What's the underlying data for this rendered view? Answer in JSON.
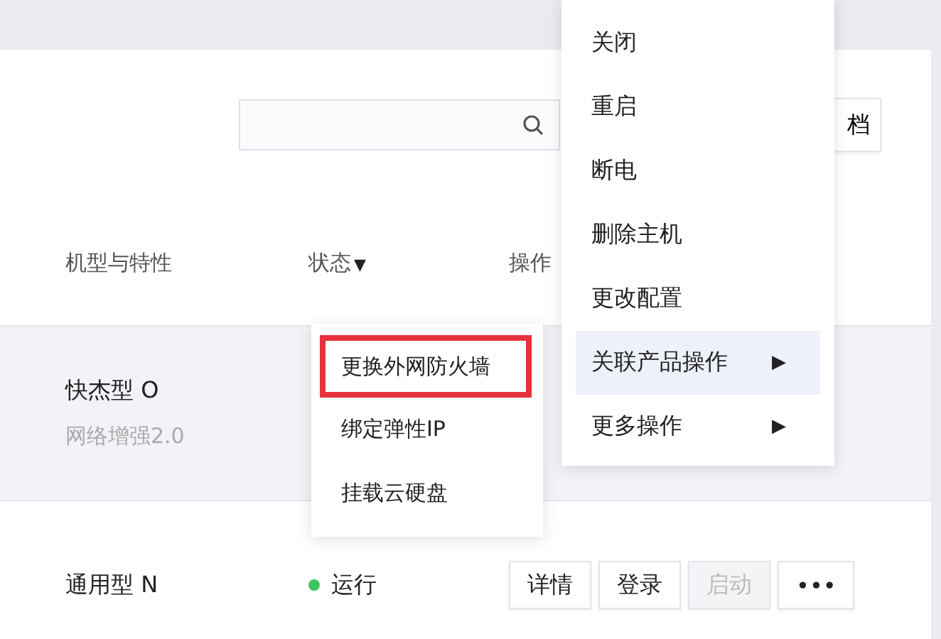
{
  "toolbar": {
    "doc_button": "档"
  },
  "table": {
    "columns": [
      {
        "label": "机型与特性",
        "kind": "plain"
      },
      {
        "label": "状态",
        "kind": "filter",
        "filter_icon": "▼"
      },
      {
        "label": "操作",
        "kind": "plain"
      }
    ],
    "rows": [
      {
        "model": "快杰型 O",
        "feature": "网络增强2.0",
        "selected": true
      },
      {
        "model": "通用型 N",
        "status": "运行",
        "color": "#3ec45a",
        "selected": false,
        "actions": [
          {
            "label": "详情",
            "disabled": false
          },
          {
            "label": "登录",
            "disabled": false
          },
          {
            "label": "启动",
            "disabled": true
          },
          {
            "label": "•••",
            "disabled": false
          }
        ]
      }
    ]
  },
  "menu": {
    "items": [
      {
        "label": "关闭",
        "kind": "action",
        "selected": false
      },
      {
        "label": "重启",
        "kind": "action",
        "selected": false
      },
      {
        "label": "断电",
        "kind": "action",
        "selected": false
      },
      {
        "label": "删除主机",
        "kind": "action",
        "selected": false
      },
      {
        "label": "更改配置",
        "kind": "action",
        "selected": false
      },
      {
        "label": "关联产品操作",
        "kind": "submenu",
        "arrow": "▶",
        "selected": true
      },
      {
        "label": "更多操作",
        "kind": "submenu",
        "arrow": "▶",
        "selected": false
      }
    ]
  },
  "submenu": {
    "items": [
      {
        "label": "更换外网防火墙",
        "annotated": true
      },
      {
        "label": "绑定弹性IP",
        "annotated": false
      },
      {
        "label": "挂载云硬盘",
        "annotated": false
      }
    ]
  }
}
